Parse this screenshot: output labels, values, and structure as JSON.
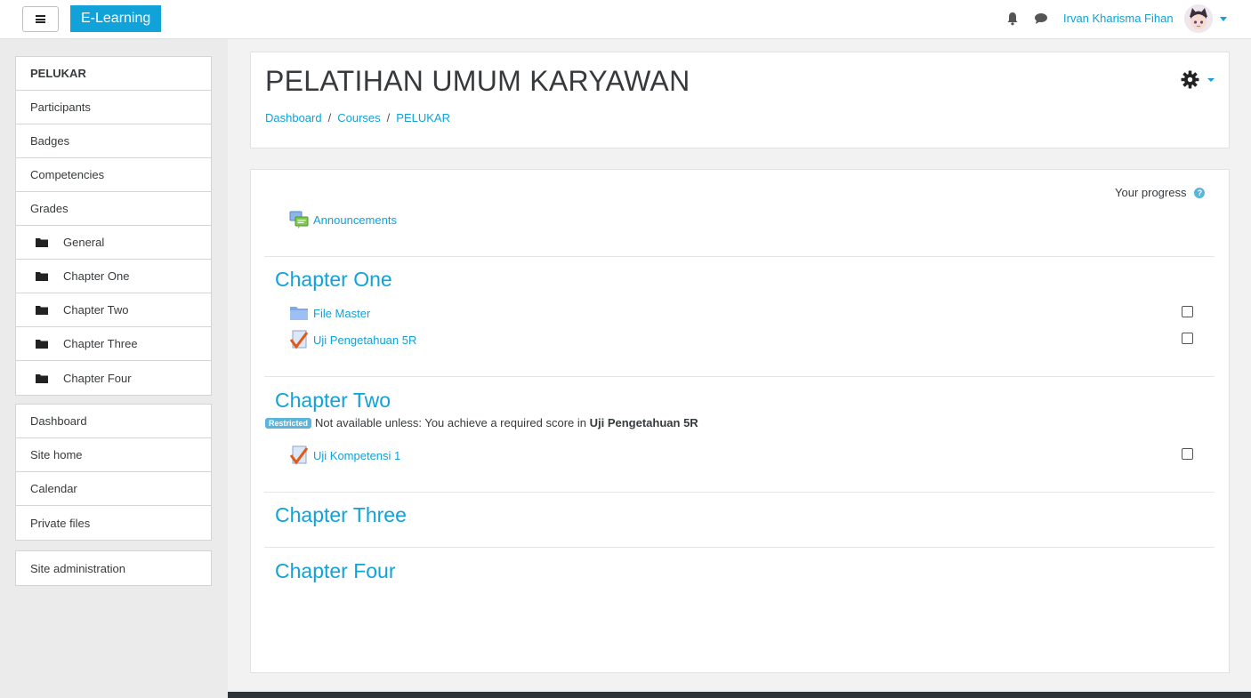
{
  "navbar": {
    "brand": "E-Learning",
    "user_name": "Irvan Kharisma Fihan",
    "icons": [
      "hamburger-icon",
      "bell-icon",
      "chat-icon",
      "avatar",
      "caret-down-icon"
    ]
  },
  "sidebar": {
    "course_nav": [
      {
        "label": "PELUKAR"
      },
      {
        "label": "Participants"
      },
      {
        "label": "Badges"
      },
      {
        "label": "Competencies"
      },
      {
        "label": "Grades"
      },
      {
        "label": "General"
      },
      {
        "label": "Chapter One"
      },
      {
        "label": "Chapter Two"
      },
      {
        "label": "Chapter Three"
      },
      {
        "label": "Chapter Four"
      }
    ],
    "site_nav": [
      {
        "label": "Dashboard"
      },
      {
        "label": "Site home"
      },
      {
        "label": "Calendar"
      },
      {
        "label": "Private files"
      }
    ],
    "admin_nav": [
      {
        "label": "Site administration"
      }
    ]
  },
  "header": {
    "title": "PELATIHAN UMUM KARYAWAN",
    "breadcrumb": [
      "Dashboard",
      "Courses",
      "PELUKAR"
    ],
    "separator": "/"
  },
  "course": {
    "progress_label": "Your progress",
    "help_glyph": "?",
    "general": {
      "activities": [
        {
          "name": "Announcements",
          "icon": "forum-icon"
        }
      ]
    },
    "sections": [
      {
        "title": "Chapter One",
        "activities": [
          {
            "name": "File Master",
            "icon": "folder-icon"
          },
          {
            "name": "Uji Pengetahuan 5R",
            "icon": "quiz-icon"
          }
        ]
      },
      {
        "title": "Chapter Two",
        "restriction": {
          "badge": "Restricted",
          "text": "Not available unless: You achieve a required score in ",
          "target": "Uji Pengetahuan 5R"
        },
        "activities": [
          {
            "name": "Uji Kompetensi 1",
            "icon": "quiz-icon"
          }
        ]
      },
      {
        "title": "Chapter Three",
        "activities": []
      },
      {
        "title": "Chapter Four",
        "activities": []
      }
    ]
  },
  "colors": {
    "accent": "#10a2d9",
    "badge": "#5bb5db",
    "drawer_bg": "#ebebeb",
    "page_bg": "#f2f2f2",
    "footer": "#2f3438"
  }
}
